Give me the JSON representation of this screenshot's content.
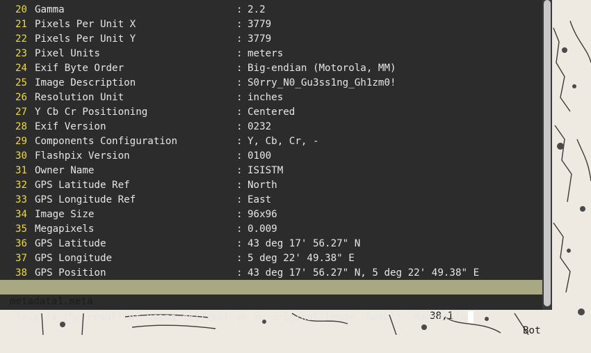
{
  "editor": {
    "lines": [
      {
        "n": "20",
        "key": "Gamma",
        "val": "2.2"
      },
      {
        "n": "21",
        "key": "Pixels Per Unit X",
        "val": "3779"
      },
      {
        "n": "22",
        "key": "Pixels Per Unit Y",
        "val": "3779"
      },
      {
        "n": "23",
        "key": "Pixel Units",
        "val": "meters"
      },
      {
        "n": "24",
        "key": "Exif Byte Order",
        "val": "Big-endian (Motorola, MM)"
      },
      {
        "n": "25",
        "key": "Image Description",
        "val": "S0rry_N0_Gu3ss1ng_Gh1zm0!"
      },
      {
        "n": "26",
        "key": "Resolution Unit",
        "val": "inches"
      },
      {
        "n": "27",
        "key": "Y Cb Cr Positioning",
        "val": "Centered"
      },
      {
        "n": "28",
        "key": "Exif Version",
        "val": "0232"
      },
      {
        "n": "29",
        "key": "Components Configuration",
        "val": "Y, Cb, Cr, -"
      },
      {
        "n": "30",
        "key": "Flashpix Version",
        "val": "0100"
      },
      {
        "n": "31",
        "key": "Owner Name",
        "val": "ISISTM"
      },
      {
        "n": "32",
        "key": "GPS Latitude Ref",
        "val": "North"
      },
      {
        "n": "33",
        "key": "GPS Longitude Ref",
        "val": "East"
      },
      {
        "n": "34",
        "key": "Image Size",
        "val": "96x96"
      },
      {
        "n": "35",
        "key": "Megapixels",
        "val": "0.009"
      },
      {
        "n": "36",
        "key": "GPS Latitude",
        "val": "43 deg 17' 56.27\" N"
      },
      {
        "n": "37",
        "key": "GPS Longitude",
        "val": "5 deg 22' 49.38\" E"
      },
      {
        "n": "38",
        "key": "GPS Position",
        "val": "43 deg 17' 56.27\" N, 5 deg 22' 49.38\" E"
      }
    ],
    "separator": ":"
  },
  "status": {
    "filename": "metadata1.meta",
    "position": "38,1",
    "scroll": "Bot"
  },
  "command": {
    "text": ":This is the result of using exiftool on my original image. Result: Marseille"
  },
  "colors": {
    "background": "#2c2c2c",
    "line_number": "#e8d84a",
    "statusbar": "#a8a882"
  }
}
